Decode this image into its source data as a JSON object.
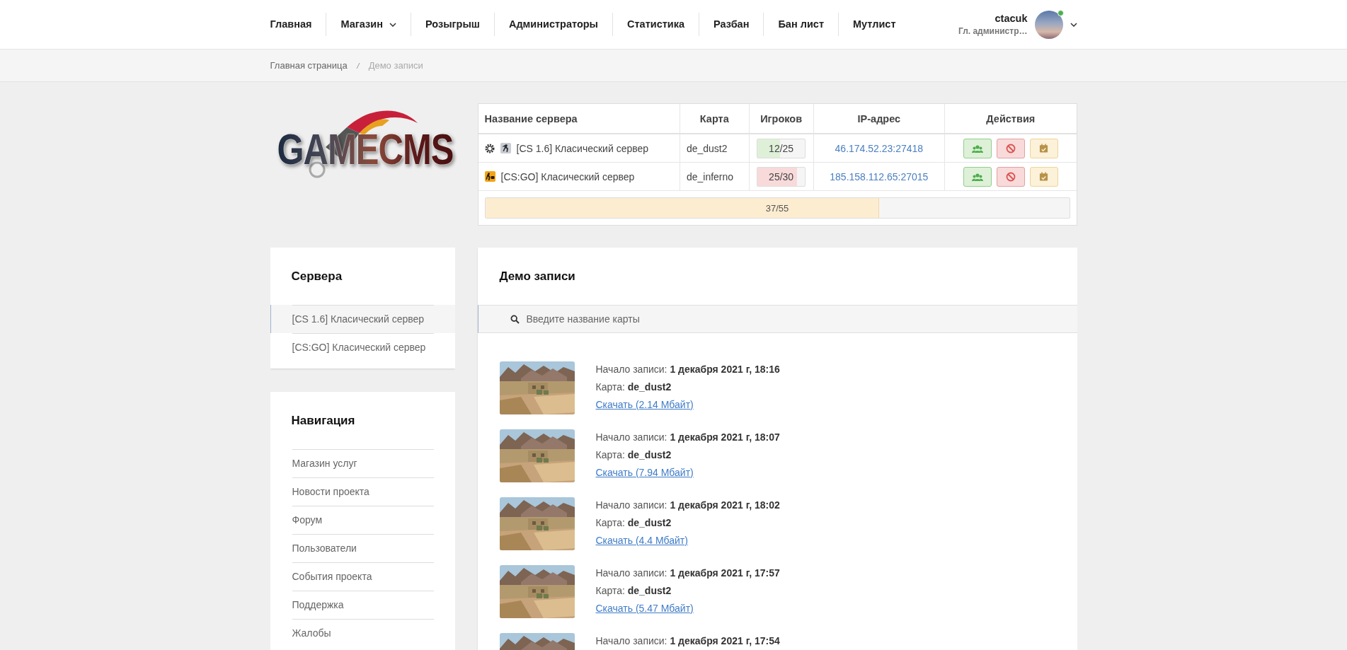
{
  "header": {
    "nav": [
      {
        "label": "Главная",
        "dropdown": false
      },
      {
        "label": "Магазин",
        "dropdown": true
      },
      {
        "label": "Розыгрыш",
        "dropdown": false
      },
      {
        "label": "Администраторы",
        "dropdown": false
      },
      {
        "label": "Статистика",
        "dropdown": false
      },
      {
        "label": "Разбан",
        "dropdown": false
      },
      {
        "label": "Бан лист",
        "dropdown": false
      },
      {
        "label": "Мутлист",
        "dropdown": false
      }
    ],
    "user": {
      "name": "ctacuk",
      "role": "Гл. администр…",
      "online": true
    }
  },
  "breadcrumb": [
    {
      "label": "Главная страница",
      "current": false
    },
    {
      "label": "Демо записи",
      "current": true
    }
  ],
  "logo": {
    "text": "GAMECMS"
  },
  "servers_table": {
    "columns": [
      "Название сервера",
      "Карта",
      "Игроков",
      "IP-адрес",
      "Действия"
    ],
    "rows": [
      {
        "kind": "cs16",
        "name": "[CS 1.6] Класический сервер",
        "map": "de_dust2",
        "players": "12/25",
        "level": 0.48,
        "color": "#dff0d8",
        "ip": "46.174.52.23:27418"
      },
      {
        "kind": "csgo",
        "name": "[CS:GO] Класический сервер",
        "map": "de_inferno",
        "players": "25/30",
        "level": 0.83,
        "color": "#f8dada",
        "ip": "185.158.112.65:27015"
      }
    ],
    "total": {
      "reading": "37/55",
      "level": 0.673
    }
  },
  "sidebar": {
    "servers": {
      "title": "Сервера",
      "items": [
        {
          "label": "[CS 1.6] Класический сервер",
          "selected": true
        },
        {
          "label": "[CS:GO] Класический сервер",
          "selected": false
        }
      ]
    },
    "navigation": {
      "title": "Навигация",
      "items": [
        "Магазин услуг",
        "Новости проекта",
        "Форум",
        "Пользователи",
        "События проекта",
        "Поддержка",
        "Жалобы"
      ]
    }
  },
  "demos": {
    "title": "Демо записи",
    "search": {
      "placeholder": "Введите название карты"
    },
    "items": [
      {
        "start": "Начало записи: **1 декабря 2021 г, 18:16**",
        "map": "Карта: **de_dust2**",
        "download": "Скачать (2.14 Мбайт)"
      },
      {
        "start": "Начало записи: **1 декабря 2021 г, 18:07**",
        "map": "Карта: **de_dust2**",
        "download": "Скачать (7.94 Мбайт)"
      },
      {
        "start": "Начало записи: **1 декабря 2021 г, 18:02**",
        "map": "Карта: **de_dust2**",
        "download": "Скачать (4.4 Мбайт)"
      },
      {
        "start": "Начало записи: **1 декабря 2021 г, 17:57**",
        "map": "Карта: **de_dust2**",
        "download": "Скачать (5.47 Мбайт)"
      },
      {
        "start": "Начало записи: **1 декабря 2021 г, 17:54**"
      }
    ]
  }
}
